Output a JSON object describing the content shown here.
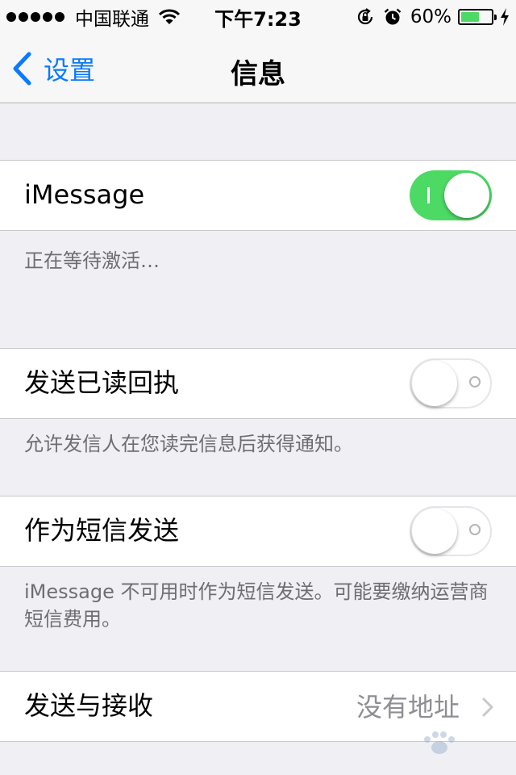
{
  "status_bar": {
    "carrier": "中国联通",
    "time": "下午7:23",
    "battery_percent": "60%",
    "battery_level": 0.6,
    "signal_bars": 5,
    "icons": [
      "signal-dots-icon",
      "wifi-icon",
      "orientation-lock-icon",
      "alarm-icon",
      "battery-icon",
      "charging-bolt-icon"
    ]
  },
  "nav": {
    "back_label": "设置",
    "title": "信息"
  },
  "settings": {
    "imessage": {
      "label": "iMessage",
      "enabled": true
    },
    "imessage_note": "正在等待激活…",
    "read_receipts": {
      "label": "发送已读回执",
      "enabled": false
    },
    "read_receipts_note": "允许发信人在您读完信息后获得通知。",
    "send_as_sms": {
      "label": "作为短信发送",
      "enabled": false
    },
    "send_as_sms_note": "iMessage 不可用时作为短信发送。可能要缴纳运营商短信费用。",
    "send_receive": {
      "label": "发送与接收",
      "value": "没有地址"
    }
  },
  "colors": {
    "accent": "#0a7aff",
    "toggle_on": "#4cd964",
    "background": "#efeff4",
    "secondary_text": "#8e8e93"
  }
}
